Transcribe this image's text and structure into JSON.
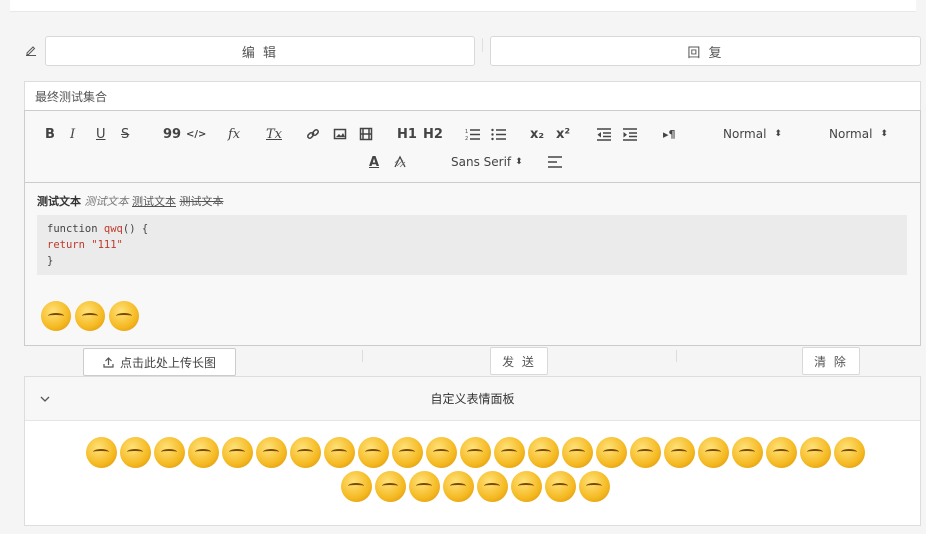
{
  "tabs": {
    "edit_label": "编 辑",
    "reply_label": "回 复"
  },
  "title_input": {
    "value": "最终测试集合"
  },
  "toolbar": {
    "bold": "B",
    "italic": "I",
    "underline": "U",
    "strike": "S",
    "quote": "99",
    "code": "</>",
    "formula": "fx",
    "clear_format": "Tx",
    "h1": "H1",
    "h2": "H2",
    "sub": "x₂",
    "sup": "x²",
    "rtl": "▸¶",
    "size_picker": "Normal",
    "header_picker": "Normal",
    "font_picker": "Sans Serif",
    "color": "A"
  },
  "content": {
    "bold_text": "测试文本",
    "italic_text": "测试文本",
    "underline_text": "测试文本",
    "strike_text": "测试文本",
    "code_line1_prefix": "function ",
    "code_line1_fn": "qwq",
    "code_line1_suffix": "() {",
    "code_line2_prefix": " return ",
    "code_line2_str": "\"111\"",
    "code_line3": "}"
  },
  "buttons": {
    "upload_label": "点击此处上传长图",
    "send_label": "发 送",
    "clear_label": "清 除"
  },
  "emoji_panel": {
    "title": "自定义表情面板",
    "count": 31
  }
}
